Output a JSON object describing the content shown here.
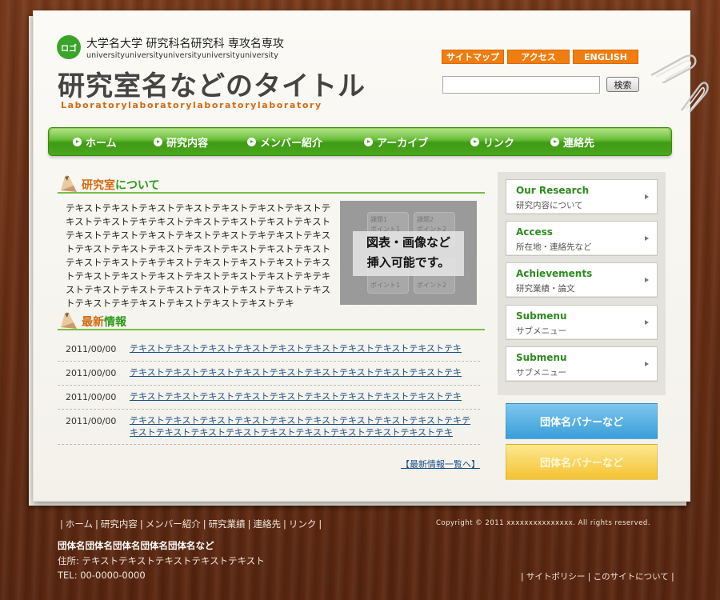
{
  "header": {
    "logo": "ロゴ",
    "university": "大学名大学 研究科名研究科 専攻名専攻",
    "university_en": "universityuniversityuniversityuniversityuniversity",
    "lab_title": "研究室名などのタイトル",
    "lab_en": "Laboratorylaboratorylaboratorylaboratory",
    "top_links": [
      "サイトマップ",
      "アクセス",
      "ENGLISH"
    ],
    "search": {
      "value": "",
      "button": "検索"
    }
  },
  "nav": [
    "ホーム",
    "研究内容",
    "メンバー紹介",
    "アーカイブ",
    "リンク",
    "連絡先"
  ],
  "about": {
    "title_a": "研究室",
    "title_b": "について",
    "text": "テキストテキストテキストテキストテキストテキストテキストテキストテキストテキテキストテキストテキストテキストテキストテキストテキストテキストテキストテキストテキテキストテキストテキストテキストテキストテキストテキストテキストテキストテキストテキストテキテキストテキストテキストテキストテキストテキストテキストテキストテキストテキストテキストテキテキストテキストテキストテキストテキストテキストテキストテキストテキストテキテキストテキストテキストテキストテキ",
    "image_caption_1": "図表・画像など",
    "image_caption_2": "挿入可能です。",
    "image_labels": [
      "課題1",
      "課題2",
      "ポイント1",
      "ポイント2",
      "ポイント1",
      "ポイント2"
    ]
  },
  "news": {
    "title_a": "最新",
    "title_b": "情報",
    "items": [
      {
        "date": "2011/00/00",
        "text": "テキストテキストテキストテキストテキストテキストテキストテキストテキストテキ"
      },
      {
        "date": "2011/00/00",
        "text": "テキストテキストテキストテキストテキストテキストテキストテキストテキストテキ"
      },
      {
        "date": "2011/00/00",
        "text": "テキストテキストテキストテキストテキストテキストテキストテキストテキストテキ"
      },
      {
        "date": "2011/00/00",
        "text": "テキストテキストテキストテキストテキストテキストテキストテキストテキストテキテキストテキストテキストテキストテキストテキストテキストテキストテキストテキ"
      }
    ],
    "more": "【最新情報一覧へ】"
  },
  "sidebar": [
    {
      "en": "Our Research",
      "ja": "研究内容について"
    },
    {
      "en": "Access",
      "ja": "所在地・連絡先など"
    },
    {
      "en": "Achievements",
      "ja": "研究業績・論文"
    },
    {
      "en": "Submenu",
      "ja": "サブメニュー"
    },
    {
      "en": "Submenu",
      "ja": "サブメニュー"
    }
  ],
  "banners": [
    "団体名バナーなど",
    "団体名バナーなど"
  ],
  "footer": {
    "links": [
      "ホーム",
      "研究内容",
      "メンバー紹介",
      "研究業績",
      "連絡先",
      "リンク"
    ],
    "copyright": "Copyright © 2011 xxxxxxxxxxxxxxx. All rights reserved.",
    "org_name": "団体名団体名団体名団体名団体名など",
    "address": "住所: テキストテキストテキストテキストテキスト",
    "tel": "TEL: 00-0000-0000",
    "links2": [
      "サイトポリシー",
      "このサイトについて"
    ]
  }
}
